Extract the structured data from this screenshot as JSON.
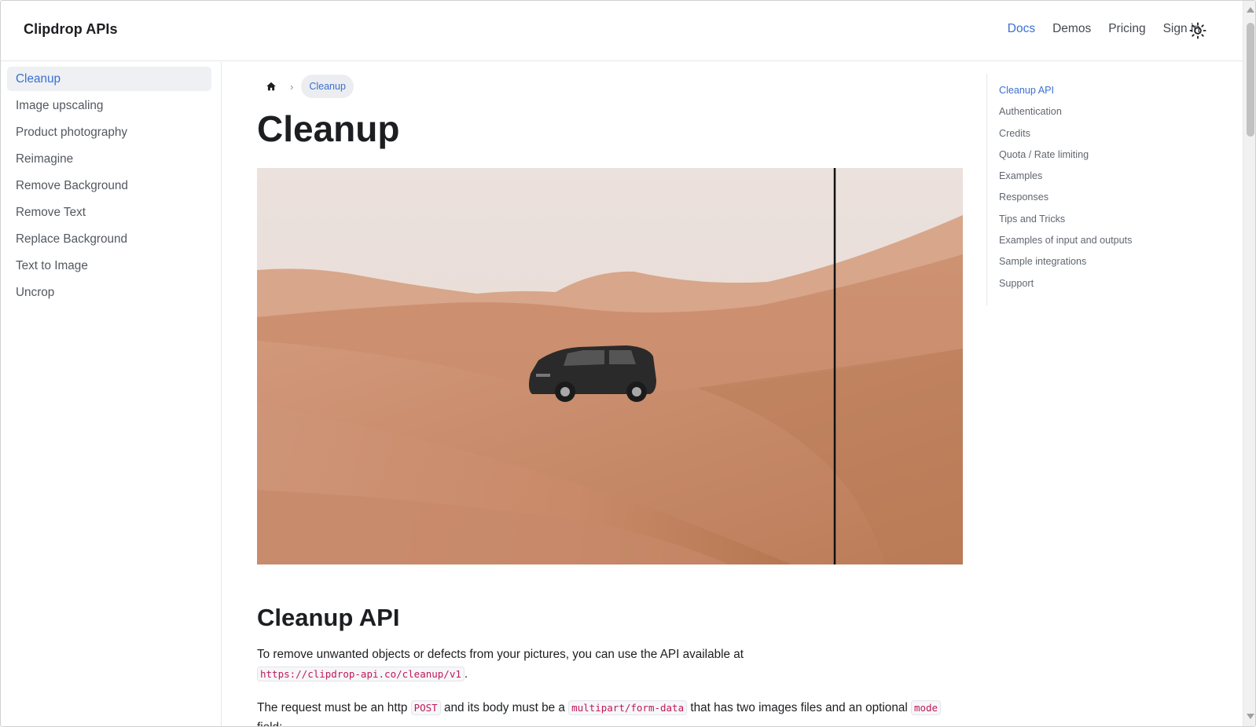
{
  "brand": "Clipdrop APIs",
  "nav": {
    "items": [
      {
        "label": "Docs",
        "active": true
      },
      {
        "label": "Demos"
      },
      {
        "label": "Pricing"
      },
      {
        "label": "Sign in"
      }
    ],
    "theme_icon": "sun-icon"
  },
  "sidebar": {
    "items": [
      {
        "label": "Cleanup",
        "active": true
      },
      {
        "label": "Image upscaling"
      },
      {
        "label": "Product photography"
      },
      {
        "label": "Reimagine"
      },
      {
        "label": "Remove Background"
      },
      {
        "label": "Remove Text"
      },
      {
        "label": "Replace Background"
      },
      {
        "label": "Text to Image"
      },
      {
        "label": "Uncrop"
      }
    ]
  },
  "breadcrumb": {
    "home_icon": "home-icon",
    "separator": "›",
    "current": "Cleanup"
  },
  "page": {
    "title": "Cleanup",
    "hero_alt": "desert-car-comparison-image",
    "section_title": "Cleanup API",
    "p1_text": "To remove unwanted objects or defects from your pictures, you can use the API available at",
    "p1_code": "https://clipdrop-api.co/cleanup/v1",
    "p1_end": ".",
    "p2_a": "The request must be an http",
    "p2_code1": "POST",
    "p2_b": "and its body must be a",
    "p2_code2": "multipart/form-data",
    "p2_c": "that has two images files and an optional",
    "p2_code3": "mode",
    "p2_d": "field:"
  },
  "toc": {
    "items": [
      {
        "label": "Cleanup API",
        "active": true
      },
      {
        "label": "Authentication"
      },
      {
        "label": "Credits"
      },
      {
        "label": "Quota / Rate limiting"
      },
      {
        "label": "Examples"
      },
      {
        "label": "Responses"
      },
      {
        "label": "Tips and Tricks"
      },
      {
        "label": "Examples of input and outputs"
      },
      {
        "label": "Sample integrations"
      },
      {
        "label": "Support"
      }
    ]
  },
  "colors": {
    "accent": "#3b6fd1",
    "code": "#c0185a",
    "sand": "#c98e6a",
    "sky": "#ece3df"
  }
}
